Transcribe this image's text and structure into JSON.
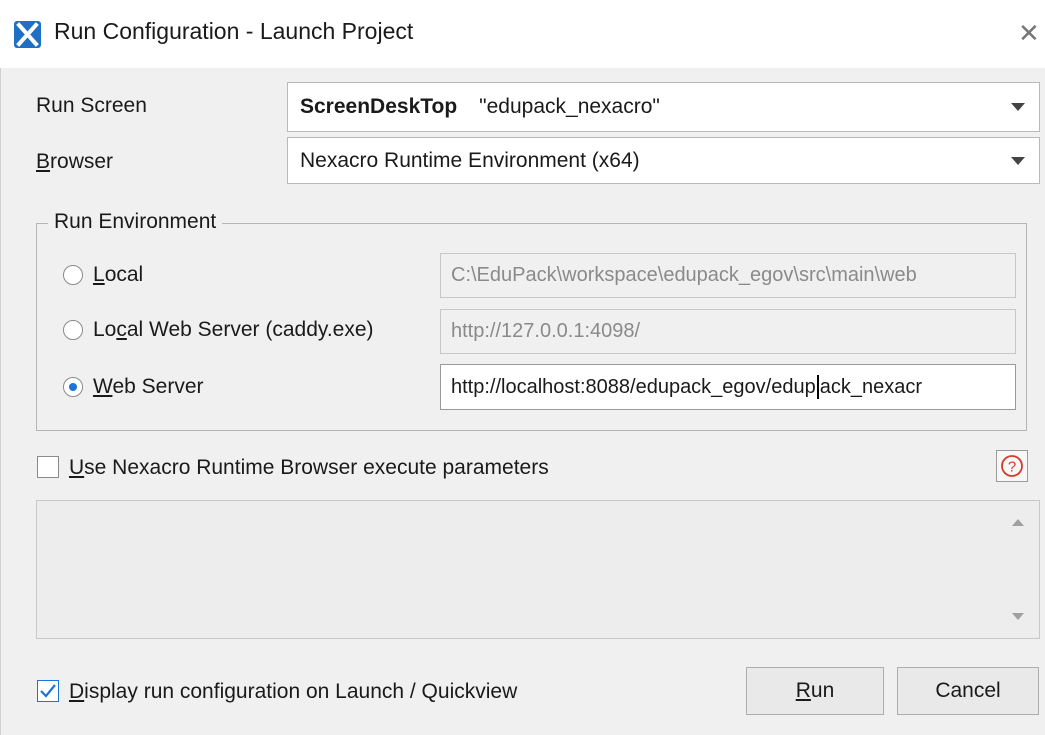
{
  "window": {
    "title": "Run Configuration - Launch Project",
    "close_glyph": "✕"
  },
  "run_screen": {
    "label": "Run Screen",
    "screen_name": "ScreenDeskTop",
    "screen_value": "\"edupack_nexacro\""
  },
  "browser": {
    "label_mnemonic": "B",
    "label_rest": "rowser",
    "value": "Nexacro Runtime Environment (x64)"
  },
  "run_environment": {
    "legend": "Run Environment",
    "local": {
      "label_mnemonic": "L",
      "label_rest": "ocal",
      "path": "C:\\EduPack\\workspace\\edupack_egov\\src\\main\\web"
    },
    "local_web_server": {
      "label_pre": "Lo",
      "label_mnemonic": "c",
      "label_rest": "al Web Server (caddy.exe)",
      "url": "http://127.0.0.1:4098/"
    },
    "web_server": {
      "label_mnemonic": "W",
      "label_rest": "eb Server",
      "url_before_caret": "http://localhost:8088/edupack_egov/edup",
      "url_after_caret": "ack_nexacr",
      "selected": true
    }
  },
  "execute_params": {
    "label_mnemonic": "U",
    "label_rest": "se Nexacro Runtime Browser execute parameters",
    "checked": false,
    "help_glyph": "?"
  },
  "footer": {
    "display_label_mnemonic": "D",
    "display_label_rest": "isplay run configuration on Launch / Quickview",
    "display_checked": true,
    "run_mnemonic": "R",
    "run_rest": "un",
    "cancel_label": "Cancel"
  },
  "colors": {
    "accent": "#1e73d8",
    "dialog_bg": "#f0f0f0",
    "title_bg": "#ffffff"
  },
  "icons": {
    "app": "nexacro-x-icon",
    "close": "close-icon",
    "dropdown": "chevron-down-icon",
    "help": "question-circle-icon",
    "check": "checkmark-icon"
  }
}
